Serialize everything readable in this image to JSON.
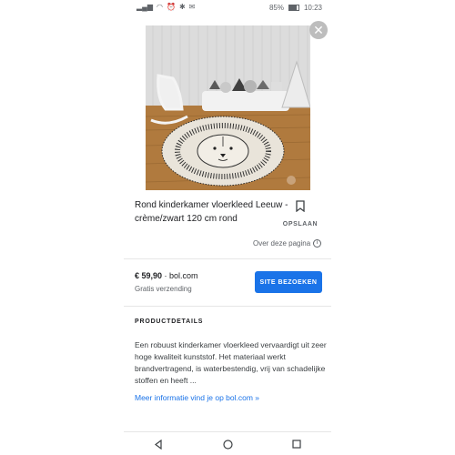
{
  "status_bar": {
    "battery_percent": "85%",
    "time": "10:23"
  },
  "product": {
    "title": "Rond kinderkamer vloerkleed Leeuw - crème/zwart 120 cm rond",
    "save_label": "OPSLAAN",
    "about_label": "Over deze pagina",
    "price": "€ 59,90",
    "seller": "bol.com",
    "shipping": "Gratis verzending",
    "visit_button": "SITE BEZOEKEN"
  },
  "details": {
    "heading": "PRODUCTDETAILS",
    "description": "Een robuust kinderkamer vloerkleed vervaardigt uit zeer hoge kwaliteit kunststof. Het materiaal werkt brandvertragend, is waterbestendig, vrij van schadelijke stoffen en heeft ...",
    "more_link": "Meer informatie vind je op bol.com »"
  },
  "colors": {
    "accent": "#1a73e8",
    "floor": "#b07a3e",
    "wall": "#d9d9d9"
  },
  "icons": {
    "close": "close-icon",
    "bookmark": "bookmark-icon",
    "info": "info-icon",
    "back": "back-icon",
    "home": "home-icon",
    "recents": "recents-icon"
  }
}
